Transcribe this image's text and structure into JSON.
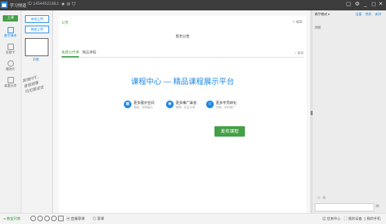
{
  "titlebar": {
    "app_name": "学习频道",
    "room_id": "ID 1454452166",
    "extra": "...1",
    "controls": {
      "window": "▢",
      "settings": "⚙",
      "minimize": "_",
      "maximize": "◻",
      "close": "✕"
    }
  },
  "leftnav": {
    "upload_label": "上课",
    "items": [
      {
        "label": "教学课件",
        "icon": "courseware-icon",
        "active": true
      },
      {
        "label": "答题卡",
        "icon": "answer-card-icon",
        "active": false
      },
      {
        "label": "播放片",
        "icon": "play-icon",
        "active": false
      },
      {
        "label": "桌面分享",
        "icon": "desktop-share-icon",
        "active": false
      }
    ]
  },
  "filepanel": {
    "local_upload": "本地上传",
    "net_upload": "网盘上传",
    "thumb_label": "白板",
    "handwritten": "其他PPT、\n音视频等\n均可尝试试"
  },
  "main": {
    "notice_label": "公告",
    "edit_label": "编辑",
    "notice_empty": "暂无公告",
    "tabs": [
      {
        "label": "免费公开课",
        "active": true
      },
      {
        "label": "精品课程",
        "active": false
      }
    ],
    "publish_link": "+ 发布",
    "headline": "课程中心 — 精品课程展示平台",
    "features": [
      {
        "title": "更多展示空间",
        "subtitle": "频道、官网展示",
        "icon": "grid-icon"
      },
      {
        "title": "更多推广渠道",
        "subtitle": "微博、社区分享",
        "icon": "weibo-icon"
      },
      {
        "title": "更多学员转化",
        "subtitle": "包装、评价推广",
        "icon": "user-icon"
      }
    ],
    "publish_button": "发布课程"
  },
  "rightpanel": {
    "mode_label": "教学模式",
    "links": [
      "设置",
      "更新",
      "关闭"
    ],
    "discuss_label": "讨论"
  },
  "statusbar": {
    "left_label": "教室列表",
    "record_label": "直播录课",
    "mute_label": "录课",
    "app_center": "应用中心",
    "my_camera": "我的设备",
    "my_screen": "我的手机"
  },
  "colors": {
    "accent_green": "#43a047",
    "accent_blue": "#1e88e5"
  }
}
